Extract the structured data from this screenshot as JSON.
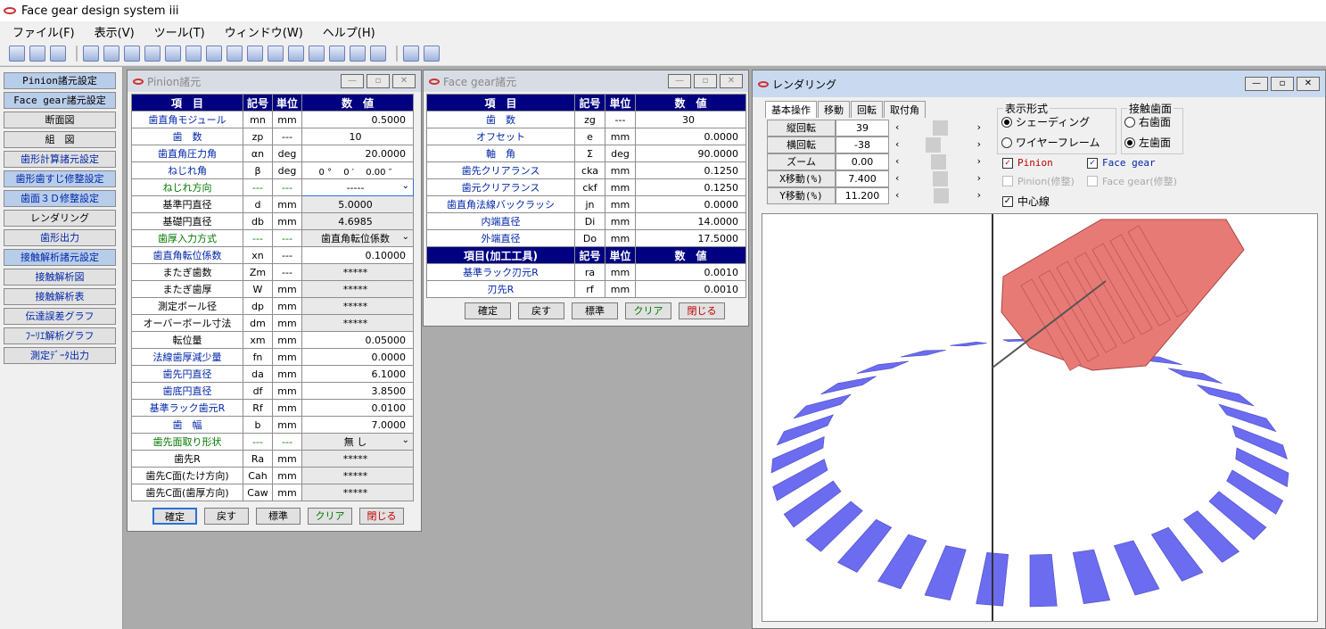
{
  "app": {
    "title": "Face gear design system iii"
  },
  "menu": [
    "ファイル(F)",
    "表示(V)",
    "ツール(T)",
    "ウィンドウ(W)",
    "ヘルプ(H)"
  ],
  "sidebar": [
    {
      "label": "Pinion諸元設定"
    },
    {
      "label": "Face gear諸元設定"
    },
    {
      "label": "断面図"
    },
    {
      "label": "組　図"
    },
    {
      "label": "歯形計算諸元設定"
    },
    {
      "label": "歯形歯すじ修整設定"
    },
    {
      "label": "歯面３Ｄ修整設定"
    },
    {
      "label": "レンダリング"
    },
    {
      "label": "歯形出力"
    },
    {
      "label": "接触解析諸元設定"
    },
    {
      "label": "接触解析図"
    },
    {
      "label": "接触解析表"
    },
    {
      "label": "伝達誤差グラフ"
    },
    {
      "label": "ﾌｰﾘｴ解析グラフ"
    },
    {
      "label": "測定ﾃﾞｰﾀ出力"
    }
  ],
  "pinion": {
    "title": "Pinion諸元",
    "headers": [
      "項　目",
      "記号",
      "単位",
      "数　値"
    ],
    "rows": [
      {
        "label": "歯直角モジュール",
        "sym": "mn",
        "unit": "mm",
        "value": "0.5000"
      },
      {
        "label": "歯　数",
        "sym": "zp",
        "unit": "---",
        "value": "10"
      },
      {
        "label": "歯直角圧力角",
        "sym": "αn",
        "unit": "deg",
        "value": "20.0000"
      },
      {
        "label": "ねじれ角",
        "sym": "β",
        "unit": "deg",
        "value": "0 °　 0 ′ 　0.00 ″"
      },
      {
        "label": "ねじれ方向",
        "sym": "---",
        "unit": "---",
        "value": "-----"
      },
      {
        "label": "基準円直径",
        "sym": "d",
        "unit": "mm",
        "value": "5.0000"
      },
      {
        "label": "基礎円直径",
        "sym": "db",
        "unit": "mm",
        "value": "4.6985"
      },
      {
        "label": "歯厚入力方式",
        "sym": "---",
        "unit": "---",
        "value": "歯直角転位係数"
      },
      {
        "label": "歯直角転位係数",
        "sym": "xn",
        "unit": "---",
        "value": "0.10000"
      },
      {
        "label": "またぎ歯数",
        "sym": "Zm",
        "unit": "---",
        "value": "*****"
      },
      {
        "label": "またぎ歯厚",
        "sym": "W",
        "unit": "mm",
        "value": "*****"
      },
      {
        "label": "測定ボール径",
        "sym": "dp",
        "unit": "mm",
        "value": "*****"
      },
      {
        "label": "オーバーボール寸法",
        "sym": "dm",
        "unit": "mm",
        "value": "*****"
      },
      {
        "label": "転位量",
        "sym": "xm",
        "unit": "mm",
        "value": "0.05000"
      },
      {
        "label": "法線歯厚減少量",
        "sym": "fn",
        "unit": "mm",
        "value": "0.0000"
      },
      {
        "label": "歯先円直径",
        "sym": "da",
        "unit": "mm",
        "value": "6.1000"
      },
      {
        "label": "歯底円直径",
        "sym": "df",
        "unit": "mm",
        "value": "3.8500"
      },
      {
        "label": "基準ラック歯元R",
        "sym": "Rf",
        "unit": "mm",
        "value": "0.0100"
      },
      {
        "label": "歯　幅",
        "sym": "b",
        "unit": "mm",
        "value": "7.0000"
      },
      {
        "label": "歯先面取り形状",
        "sym": "---",
        "unit": "---",
        "value": "無 し"
      },
      {
        "label": "歯先R",
        "sym": "Ra",
        "unit": "mm",
        "value": "*****"
      },
      {
        "label": "歯先C面(たけ方向)",
        "sym": "Cah",
        "unit": "mm",
        "value": "*****"
      },
      {
        "label": "歯先C面(歯厚方向)",
        "sym": "Caw",
        "unit": "mm",
        "value": "*****"
      }
    ],
    "buttons": [
      "確定",
      "戻す",
      "標準",
      "クリア",
      "閉じる"
    ]
  },
  "facegear": {
    "title": "Face gear諸元",
    "headers": [
      "項　目",
      "記号",
      "単位",
      "数　値"
    ],
    "rows": [
      {
        "label": "歯　数",
        "sym": "zg",
        "unit": "---",
        "value": "30"
      },
      {
        "label": "オフセット",
        "sym": "e",
        "unit": "mm",
        "value": "0.0000"
      },
      {
        "label": "軸　角",
        "sym": "Σ",
        "unit": "deg",
        "value": "90.0000"
      },
      {
        "label": "歯先クリアランス",
        "sym": "cka",
        "unit": "mm",
        "value": "0.1250"
      },
      {
        "label": "歯元クリアランス",
        "sym": "ckf",
        "unit": "mm",
        "value": "0.1250"
      },
      {
        "label": "歯直角法線バックラッシ",
        "sym": "jn",
        "unit": "mm",
        "value": "0.0000"
      },
      {
        "label": "内端直径",
        "sym": "Di",
        "unit": "mm",
        "value": "14.0000"
      },
      {
        "label": "外端直径",
        "sym": "Do",
        "unit": "mm",
        "value": "17.5000"
      }
    ],
    "tool_headers": [
      "項目(加工工具)",
      "記号",
      "単位",
      "数　値"
    ],
    "tool_rows": [
      {
        "label": "基準ラック刃元R",
        "sym": "ra",
        "unit": "mm",
        "value": "0.0010"
      },
      {
        "label": "刃先R",
        "sym": "rf",
        "unit": "mm",
        "value": "0.0010"
      }
    ],
    "buttons": [
      "確定",
      "戻す",
      "標準",
      "クリア",
      "閉じる"
    ]
  },
  "render": {
    "title": "レンダリング",
    "tabs": [
      "基本操作",
      "移動",
      "回転",
      "取付角"
    ],
    "controls": [
      {
        "label": "縦回転",
        "value": "39"
      },
      {
        "label": "横回転",
        "value": "-38"
      },
      {
        "label": "ズーム",
        "value": "0.00"
      },
      {
        "label": "X移動(%)",
        "value": "7.400"
      },
      {
        "label": "Y移動(%)",
        "value": "11.200"
      }
    ],
    "display_group": "表示形式",
    "display_opts": [
      "シェーディング",
      "ワイヤーフレーム"
    ],
    "contact_group": "接触歯面",
    "contact_opts": [
      "右歯面",
      "左歯面"
    ],
    "checks": {
      "pinion": "Pinion",
      "face_gear": "Face gear",
      "pinion_mod": "Pinion(修整)",
      "face_gear_mod": "Face gear(修整)",
      "center_line": "中心線"
    },
    "colors": {
      "face_gear": "#6b6cf0",
      "pinion": "#e87a76"
    }
  }
}
